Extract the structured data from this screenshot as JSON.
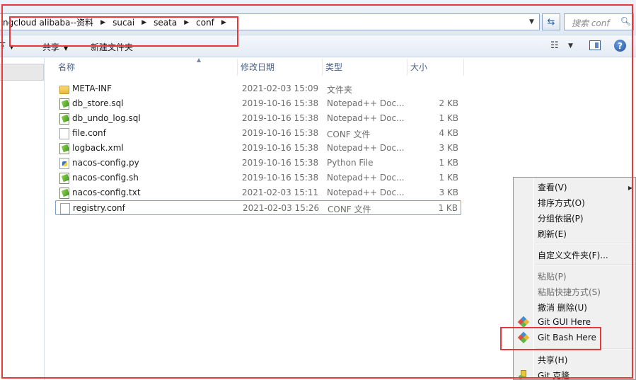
{
  "address_bar": {
    "breadcrumbs": [
      "ngcloud alibaba--资料",
      "sucai",
      "seata",
      "conf"
    ],
    "search_placeholder": "搜索 conf"
  },
  "toolbar": {
    "organize_label": "Ŧ",
    "share_label": "共享",
    "new_folder_label": "新建文件夹"
  },
  "file_list": {
    "columns": [
      "名称",
      "修改日期",
      "类型",
      "大小"
    ],
    "files": [
      {
        "name": "META-INF",
        "date": "2021-02-03 15:09",
        "type": "文件夹",
        "size": "",
        "icon": "folder-icon"
      },
      {
        "name": "db_store.sql",
        "date": "2019-10-16 15:38",
        "type": "Notepad++ Doc...",
        "size": "2 KB",
        "icon": "notepad-plus-plus-file-icon"
      },
      {
        "name": "db_undo_log.sql",
        "date": "2019-10-16 15:38",
        "type": "Notepad++ Doc...",
        "size": "1 KB",
        "icon": "notepad-plus-plus-file-icon"
      },
      {
        "name": "file.conf",
        "date": "2019-10-16 15:38",
        "type": "CONF 文件",
        "size": "4 KB",
        "icon": "blank-file-icon"
      },
      {
        "name": "logback.xml",
        "date": "2019-10-16 15:38",
        "type": "Notepad++ Doc...",
        "size": "3 KB",
        "icon": "notepad-plus-plus-file-icon"
      },
      {
        "name": "nacos-config.py",
        "date": "2019-10-16 15:38",
        "type": "Python File",
        "size": "1 KB",
        "icon": "python-file-icon"
      },
      {
        "name": "nacos-config.sh",
        "date": "2019-10-16 15:38",
        "type": "Notepad++ Doc...",
        "size": "1 KB",
        "icon": "notepad-plus-plus-file-icon"
      },
      {
        "name": "nacos-config.txt",
        "date": "2021-02-03 15:11",
        "type": "Notepad++ Doc...",
        "size": "3 KB",
        "icon": "notepad-plus-plus-file-icon"
      },
      {
        "name": "registry.conf",
        "date": "2021-02-03 15:26",
        "type": "CONF 文件",
        "size": "1 KB",
        "icon": "blank-file-icon"
      }
    ]
  },
  "context_menu": {
    "items": [
      {
        "label": "查看(V)",
        "enabled": true
      },
      {
        "label": "排序方式(O)",
        "enabled": true
      },
      {
        "label": "分组依据(P)",
        "enabled": true
      },
      {
        "label": "刷新(E)",
        "enabled": true
      },
      {
        "label": "自定义文件夹(F)...",
        "enabled": true
      },
      {
        "label": "粘贴(P)",
        "enabled": false
      },
      {
        "label": "粘贴快捷方式(S)",
        "enabled": false
      },
      {
        "label": "撤消 删除(U)",
        "enabled": true
      },
      {
        "label": "Git GUI Here",
        "enabled": true,
        "icon": "git-icon"
      },
      {
        "label": "Git Bash Here",
        "enabled": true,
        "icon": "git-icon"
      },
      {
        "label": "共享(H)",
        "enabled": true
      },
      {
        "label": "Git 克隆...",
        "enabled": true,
        "icon": "git-clone-icon"
      }
    ]
  },
  "colors": {
    "annotation_red": "#e8383b",
    "selection_border": "#7da2ce",
    "header_text": "#4d6185"
  }
}
